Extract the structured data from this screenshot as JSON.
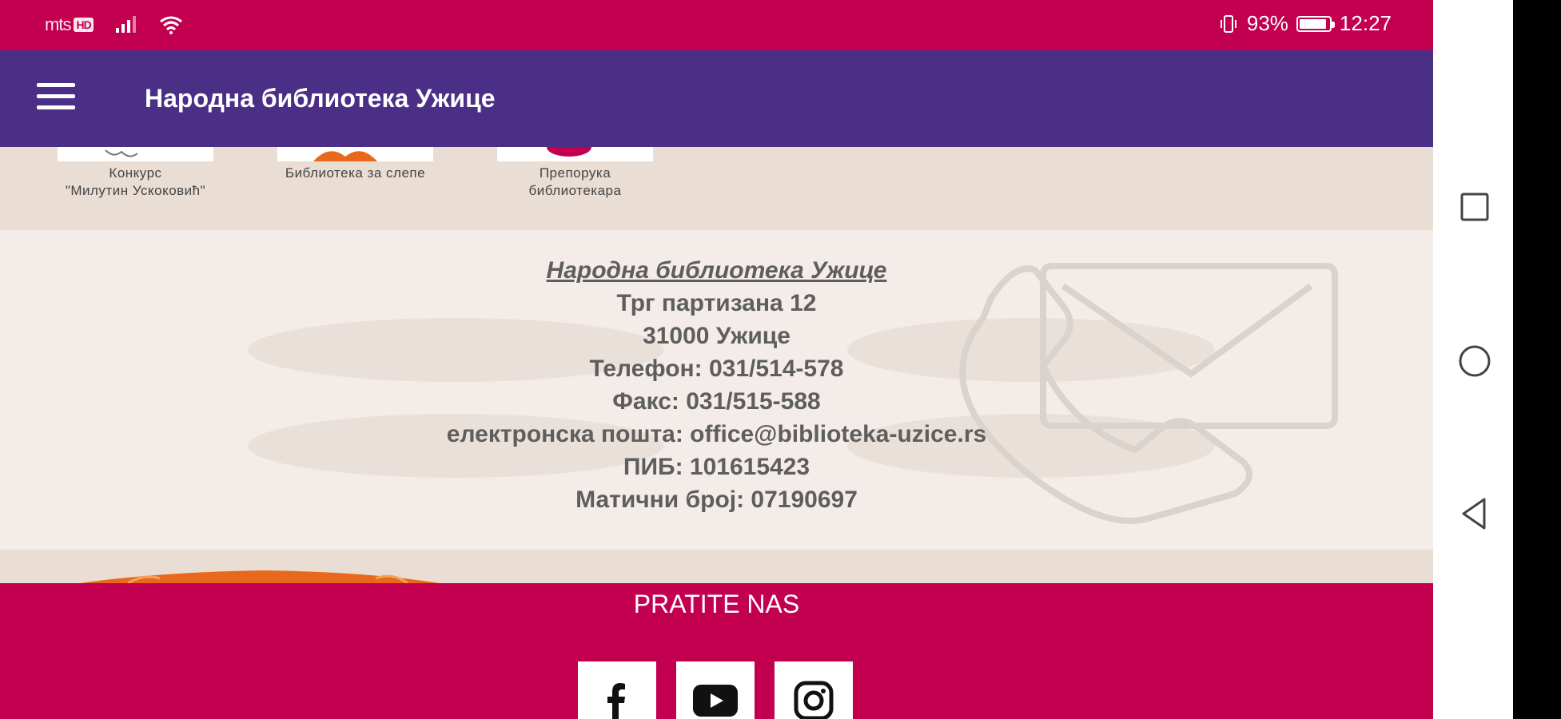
{
  "status_bar": {
    "carrier": "mts",
    "network_badge": "HD",
    "battery_percent": "93%",
    "battery_level": 0.93,
    "time": "12:27"
  },
  "app_bar": {
    "title": "Народна библиотека Ужице",
    "menu_icon": "hamburger-menu-icon"
  },
  "tiles": [
    {
      "caption_line1": "Конкурс",
      "caption_line2": "\"Милутин Ускоковић\""
    },
    {
      "caption_line1": "Библиотека за слепе"
    },
    {
      "caption_line1": "Препорука библиотекара"
    }
  ],
  "contact": {
    "name": "Народна библиотека Ужице",
    "address": "Трг партизана 12",
    "city": "31000 Ужице",
    "phone": "Телефон: 031/514-578",
    "fax": "Факс: 031/515-588",
    "email": "електронска пошта: office@biblioteka-uzice.rs",
    "pib": "ПИБ: 101615423",
    "reg_number": "Матични број: 07190697"
  },
  "footer": {
    "follow_label": "PRATITE NAS",
    "social": [
      {
        "icon": "facebook-icon"
      },
      {
        "icon": "youtube-icon"
      },
      {
        "icon": "instagram-icon"
      }
    ]
  },
  "nav_bar": {
    "buttons": [
      "recents-icon",
      "home-icon",
      "back-icon"
    ]
  },
  "colors": {
    "status_bar": "#c2004f",
    "app_bar": "#4b2f87",
    "footer": "#c2004f",
    "contact_text": "#5e5e5e"
  }
}
